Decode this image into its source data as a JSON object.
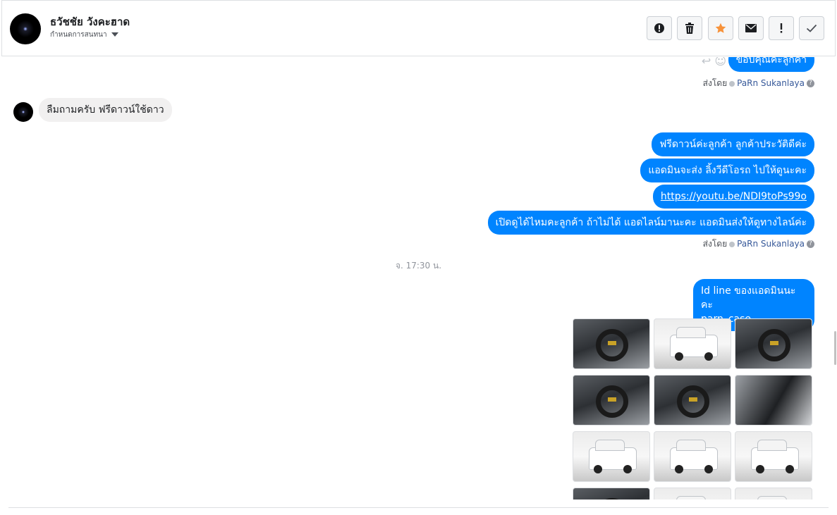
{
  "contact": {
    "name": "ธวัชชัย วังคะฮาด",
    "subtitle": "กำหนดการสนทนา"
  },
  "toolbar": {
    "buttons": [
      {
        "name": "spam",
        "icon": "alert-circle-icon"
      },
      {
        "name": "delete",
        "icon": "trash-icon"
      },
      {
        "name": "star",
        "icon": "star-icon"
      },
      {
        "name": "mark-unread",
        "icon": "envelope-icon"
      },
      {
        "name": "follow-up",
        "icon": "exclamation-icon"
      },
      {
        "name": "mark-done",
        "icon": "check-icon"
      }
    ]
  },
  "colors": {
    "outgoing_bubble": "#0084ff",
    "incoming_bubble": "#f1f0f0",
    "star": "#f7923a",
    "agent_link": "#365899"
  },
  "messages": {
    "top_out": "ขอบคุณค่ะลูกค้า",
    "sent_by_1": {
      "label": "ส่งโดย",
      "agent": "PaRn Sukanlaya",
      "help": "?"
    },
    "incoming": "ลืมถามครับ ฟรีดาวน์ใช้ดาว",
    "out_1": "ฟรีดาวน์ค่ะลูกค้า ลูกค้าประวัติดีค่ะ",
    "out_2": "แอดมินจะส่ง ลิ้งวีดีโอรถ ไปให้ดูนะคะ",
    "out_3": "https://youtu.be/NDI9toPs99o",
    "out_4": "เปิดดูได้ไหมคะลูกค้า ถ้าไม่ได้ แอดไลน์มานะคะ  แอดมินส่งให้ดูทางไลน์ค่ะ",
    "sent_by_2": {
      "label": "ส่งโดย",
      "agent": "PaRn Sukanlaya",
      "help": "?"
    },
    "timestamp": "จ. 17:30 น.",
    "out_5_line1": "Id line  ของแอดมินนะคะ",
    "out_5_line2": "parn_case"
  },
  "photos": [
    {
      "kind": "interior",
      "label": "car-interior-photo"
    },
    {
      "kind": "exterior",
      "label": "car-rear-photo"
    },
    {
      "kind": "interior",
      "label": "steering-wheel-photo"
    },
    {
      "kind": "interior",
      "label": "dashboard-photo"
    },
    {
      "kind": "interior",
      "label": "cabin-photo"
    },
    {
      "kind": "door",
      "label": "door-panel-photo"
    },
    {
      "kind": "exterior",
      "label": "car-front-left-photo"
    },
    {
      "kind": "exterior",
      "label": "car-front-photo"
    },
    {
      "kind": "exterior",
      "label": "car-front-right-photo"
    },
    {
      "kind": "interior",
      "label": "car-photo-10"
    },
    {
      "kind": "exterior",
      "label": "car-photo-11"
    },
    {
      "kind": "exterior",
      "label": "car-photo-12"
    }
  ]
}
